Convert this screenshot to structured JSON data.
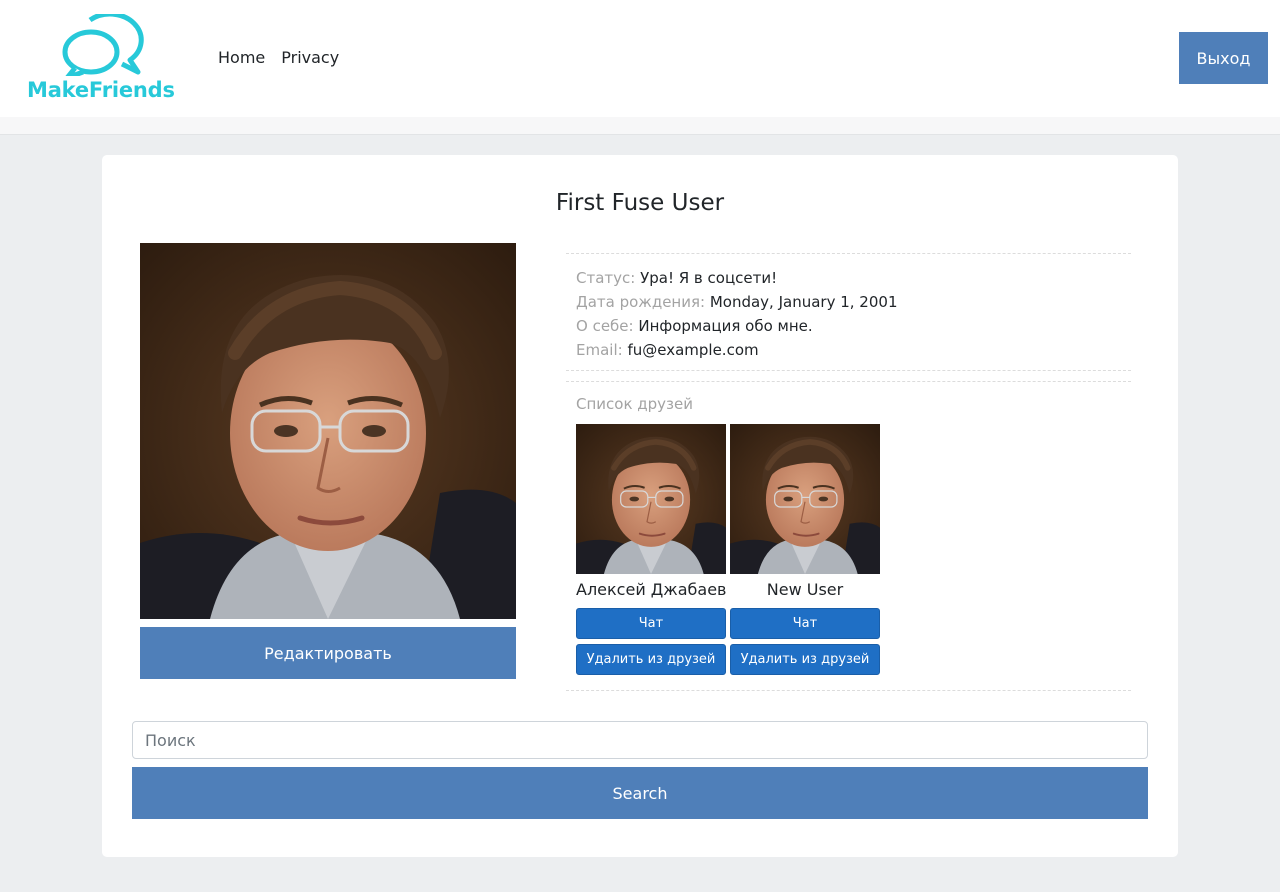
{
  "header": {
    "logo_text": "MakeFriends",
    "nav": [
      {
        "label": "Home"
      },
      {
        "label": "Privacy"
      }
    ],
    "logout_label": "Выход"
  },
  "profile": {
    "name": "First Fuse User",
    "edit_label": "Редактировать",
    "info": {
      "status_label": "Статус:",
      "status_value": "Ура! Я в соцсети!",
      "birthday_label": "Дата рождения:",
      "birthday_value": "Monday, January 1, 2001",
      "about_label": "О себе:",
      "about_value": "Информация обо мне.",
      "email_label": "Email:",
      "email_value": "fu@example.com"
    },
    "friends_title": "Список друзей",
    "friends": [
      {
        "name": "Алексей Джабаев",
        "chat_label": "Чат",
        "remove_label": "Удалить из друзей"
      },
      {
        "name": "New User",
        "chat_label": "Чат",
        "remove_label": "Удалить из друзей"
      }
    ]
  },
  "search": {
    "placeholder": "Поиск",
    "button_label": "Search"
  },
  "colors": {
    "brand": "#27c9d9",
    "primary_button": "#4f7fb9",
    "friend_button": "#1f6fc5",
    "background": "#eceef0"
  }
}
